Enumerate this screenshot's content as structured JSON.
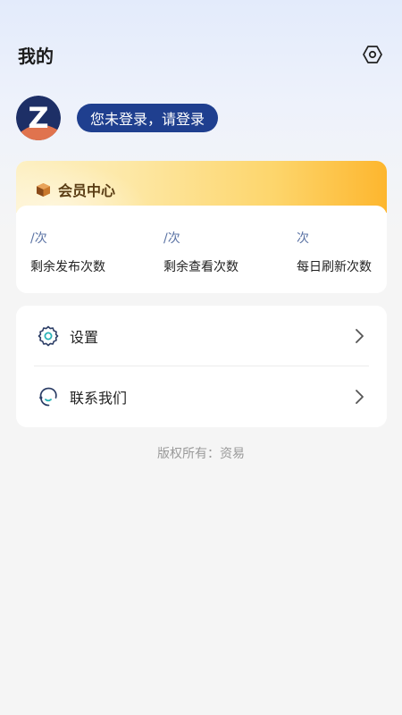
{
  "header": {
    "title": "我的",
    "settings_icon": "hexagon-gear-icon"
  },
  "profile": {
    "avatar_letter": "Z",
    "login_prompt": "您未登录，请登录"
  },
  "member_center": {
    "title": "会员中心",
    "icon": "box-icon",
    "stats": [
      {
        "value": "/次",
        "label": "剩余发布次数"
      },
      {
        "value": "/次",
        "label": "剩余查看次数"
      },
      {
        "value": "次",
        "label": "每日刷新次数"
      }
    ]
  },
  "menu": {
    "items": [
      {
        "label": "设置",
        "icon": "settings-gear-icon"
      },
      {
        "label": "联系我们",
        "icon": "headset-icon"
      }
    ]
  },
  "footer": {
    "copyright": "版权所有：资易"
  },
  "colors": {
    "login_pill": "#1f3f8f",
    "member_gradient_end": "#fdb62e",
    "stat_value": "#5b73a4"
  }
}
